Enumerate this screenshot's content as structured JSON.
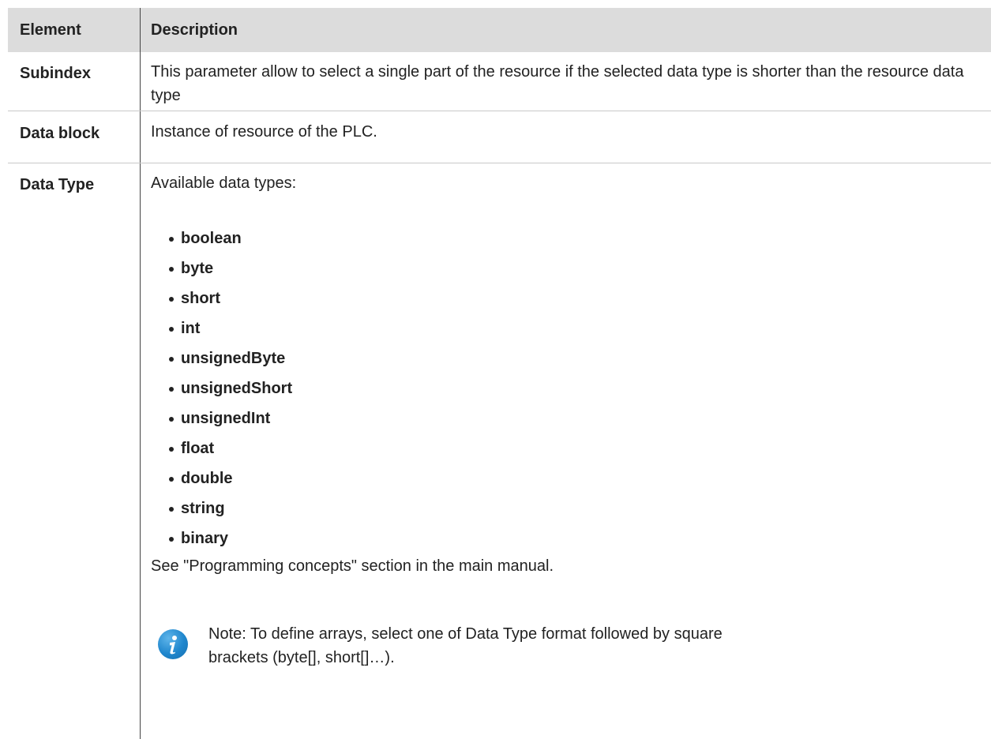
{
  "table": {
    "headers": [
      "Element",
      "Description"
    ],
    "rows": [
      {
        "element": "Subindex",
        "description": "This parameter allow to select a single part of the resource if the selected data type is shorter than the resource data type"
      },
      {
        "element": "Data block",
        "description": "Instance of resource of the PLC."
      },
      {
        "element": "Data Type",
        "description": "Available data types:",
        "types": [
          "boolean",
          "byte",
          "short",
          "int",
          "unsignedByte",
          "unsignedShort",
          "unsignedInt",
          "float",
          "double",
          "string",
          "binary"
        ],
        "see_also": "See \"Programming concepts\" section in the main manual.",
        "note": "Note: To define arrays, select one of Data Type format followed by square brackets (byte[], short[]…).",
        "note_icon": "info-icon"
      }
    ]
  },
  "colors": {
    "header_bg": "#dcdcdc",
    "text": "#222222",
    "info_icon": "#1f86cd"
  }
}
